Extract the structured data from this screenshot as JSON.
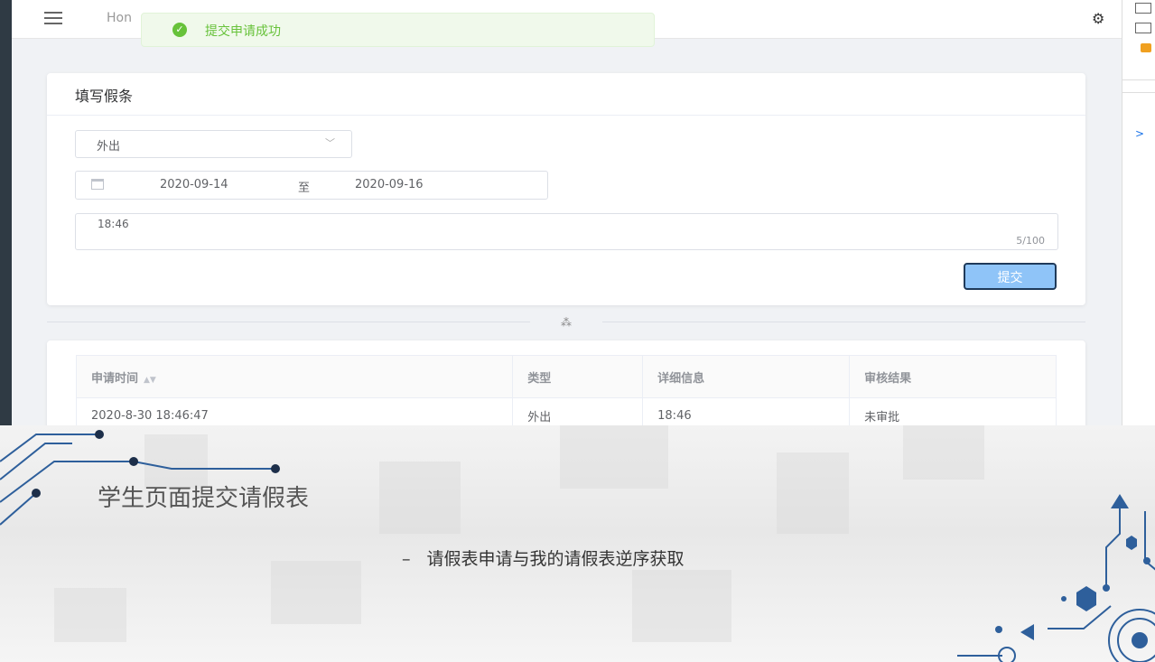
{
  "header": {
    "breadcrumb": "Hon"
  },
  "toast": {
    "message": "提交申请成功"
  },
  "form": {
    "title": "填写假条",
    "type_value": "外出",
    "start_date": "2020-09-14",
    "range_separator": "至",
    "end_date": "2020-09-16",
    "detail_value": "18:46",
    "char_count": "5/100",
    "submit_label": "提交"
  },
  "table": {
    "headers": [
      "申请时间",
      "类型",
      "详细信息",
      "审核结果"
    ],
    "rows": [
      [
        "2020-8-30 18:46:47",
        "外出",
        "18:46",
        "未审批"
      ]
    ]
  },
  "slide": {
    "heading": "学生页面提交请假表",
    "bullet_marker": "–",
    "bullet": "请假表申请与我的请假表逆序获取"
  },
  "colors": {
    "success": "#67c23a",
    "primary_button": "#8fc4f8",
    "sidebar": "#2f3a44"
  },
  "icons": [
    "menu-icon",
    "settings-icon",
    "success-check-icon",
    "chevron-down-icon",
    "calendar-icon",
    "sort-icon",
    "loading-icon"
  ]
}
